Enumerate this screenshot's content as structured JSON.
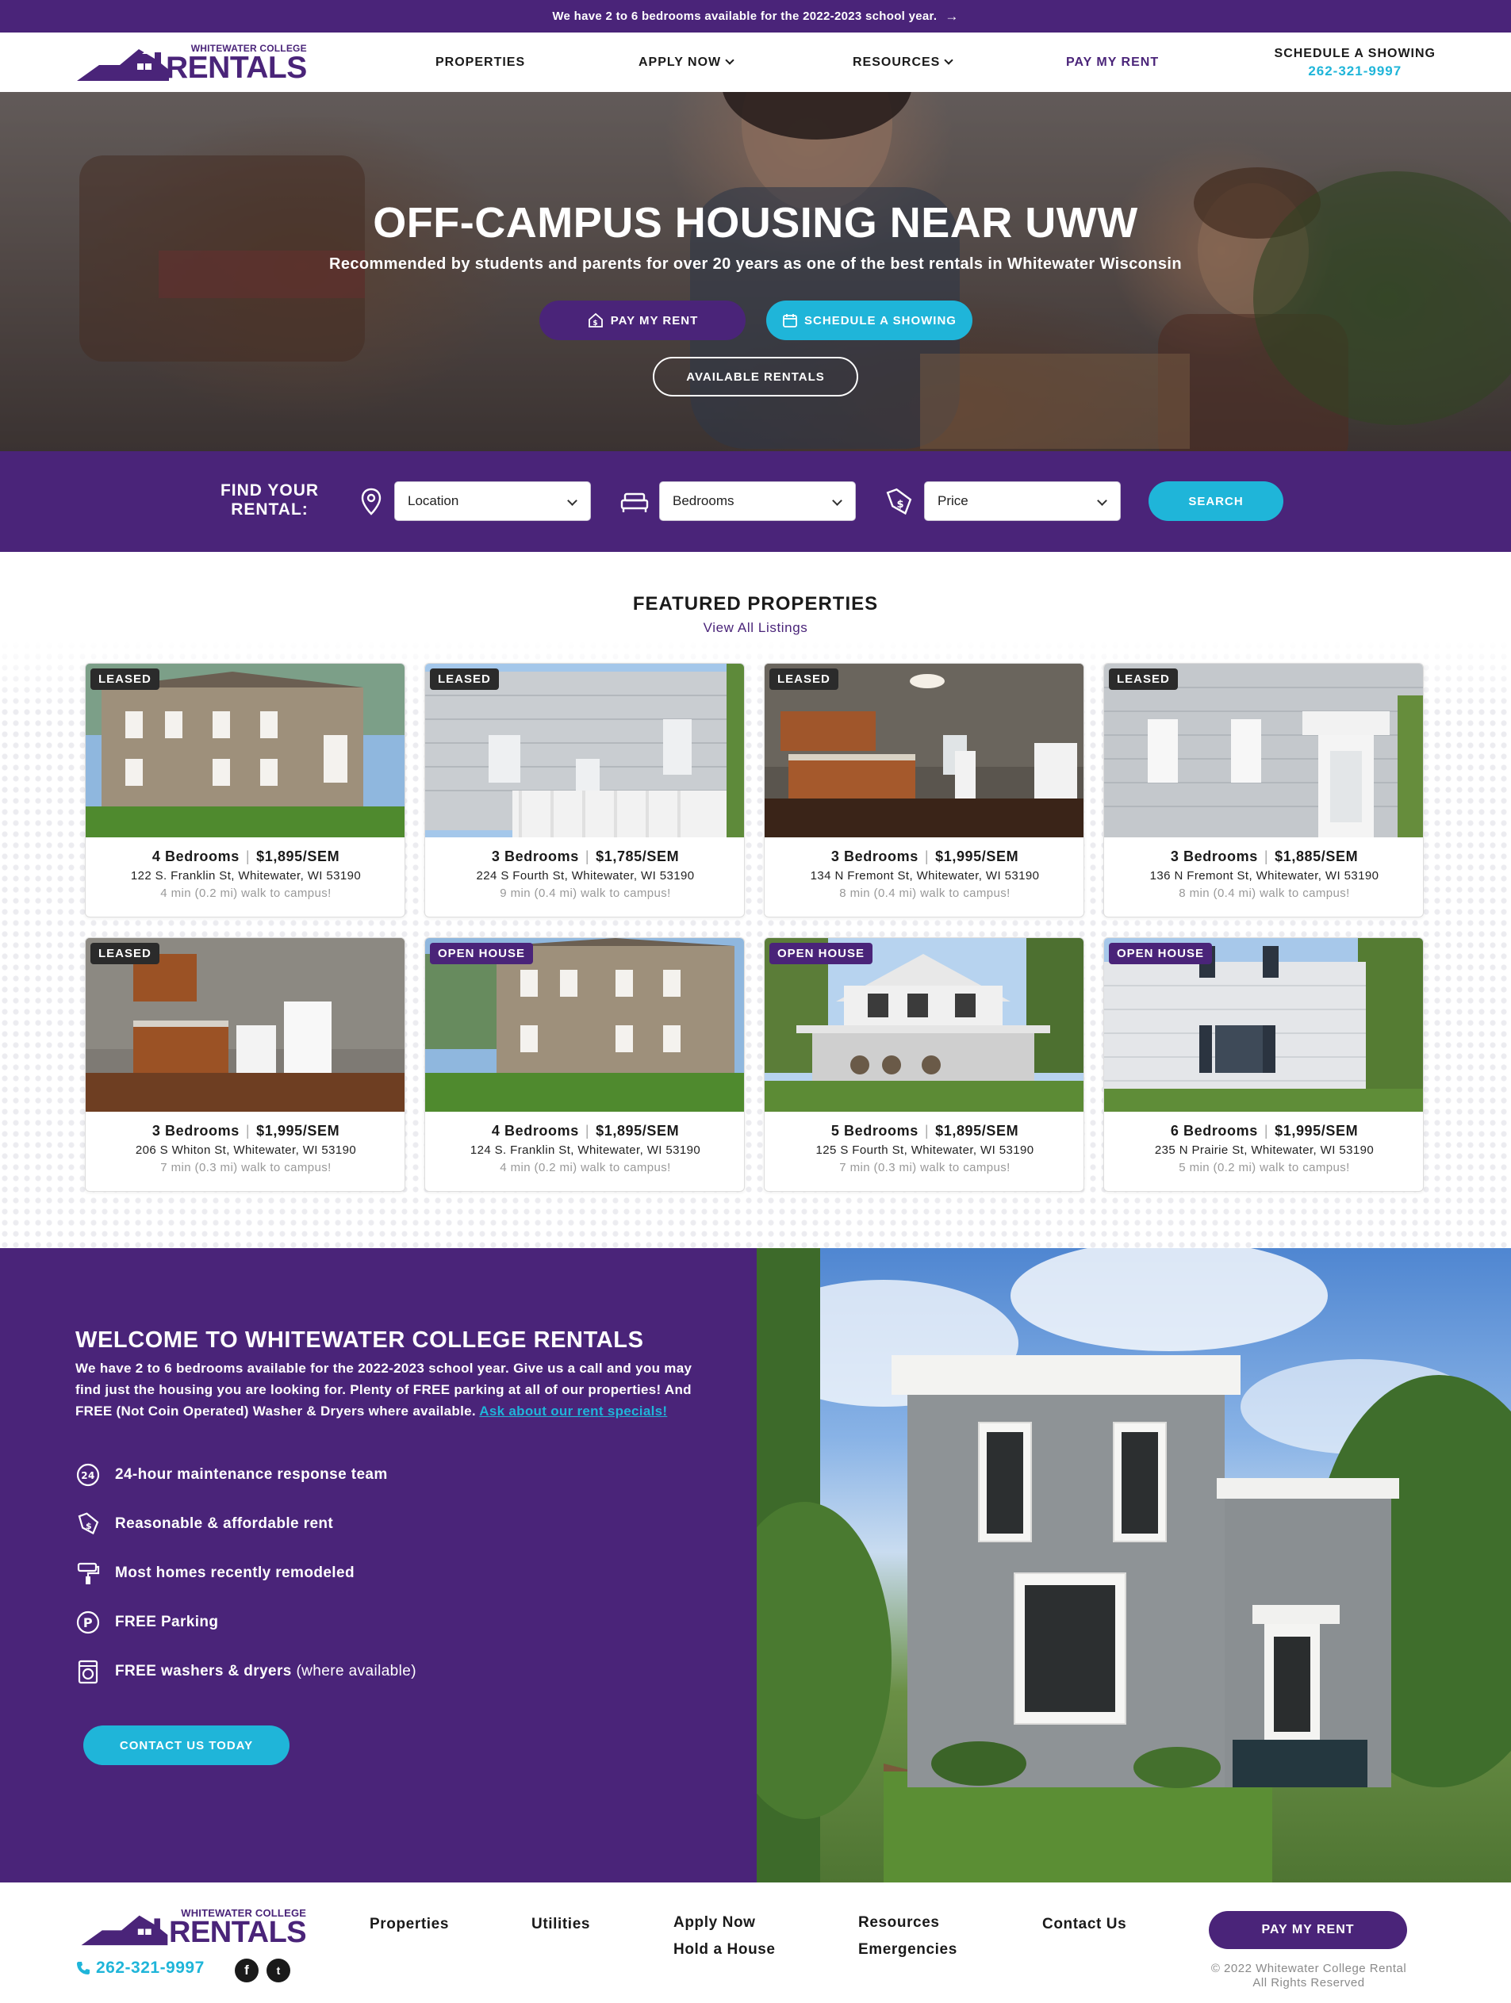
{
  "announcement": {
    "text": "We have 2 to 6 bedrooms available for the 2022-2023 school year.",
    "arrow_icon": "arrow-right-icon"
  },
  "brand": {
    "small": "WHITEWATER COLLEGE",
    "big": "RENTALS",
    "footer_small": "WHITEWATER COLLEGE",
    "footer_big": "RENTALS"
  },
  "nav": {
    "properties": "PROPERTIES",
    "apply_now": "APPLY NOW",
    "resources": "RESOURCES",
    "pay_my_rent": "PAY MY RENT",
    "cta_label": "SCHEDULE A SHOWING",
    "cta_phone": "262-321-9997"
  },
  "hero": {
    "title": "OFF-CAMPUS HOUSING NEAR UWW",
    "subtitle": "Recommended by students and parents for over 20 years as one of the best rentals in Whitewater Wisconsin",
    "pay_rent": "PAY MY RENT",
    "schedule": "SCHEDULE A SHOWING",
    "available": "AVAILABLE RENTALS"
  },
  "search": {
    "label_line1": "FIND YOUR",
    "label_line2": "RENTAL:",
    "location": "Location",
    "bedrooms": "Bedrooms",
    "price": "Price",
    "button": "SEARCH"
  },
  "featured": {
    "title": "FEATURED PROPERTIES",
    "view_all": "View All Listings",
    "cards": [
      {
        "badge": "LEASED",
        "beds": "4 Bedrooms",
        "price": "$1,895/SEM",
        "address": "122 S. Franklin St, Whitewater, WI 53190",
        "walk": "4 min (0.2 mi) walk to campus!"
      },
      {
        "badge": "LEASED",
        "beds": "3 Bedrooms",
        "price": "$1,785/SEM",
        "address": "224 S Fourth St, Whitewater, WI 53190",
        "walk": "9 min (0.4 mi) walk to campus!"
      },
      {
        "badge": "LEASED",
        "beds": "3 Bedrooms",
        "price": "$1,995/SEM",
        "address": "134 N Fremont St, Whitewater, WI 53190",
        "walk": "8 min (0.4 mi) walk to campus!"
      },
      {
        "badge": "LEASED",
        "beds": "3 Bedrooms",
        "price": "$1,885/SEM",
        "address": "136 N Fremont St, Whitewater, WI 53190",
        "walk": "8 min (0.4 mi) walk to campus!"
      },
      {
        "badge": "LEASED",
        "beds": "3 Bedrooms",
        "price": "$1,995/SEM",
        "address": "206 S Whiton St, Whitewater, WI 53190",
        "walk": "7 min (0.3 mi) walk to campus!"
      },
      {
        "badge": "OPEN HOUSE",
        "beds": "4 Bedrooms",
        "price": "$1,895/SEM",
        "address": "124 S. Franklin St, Whitewater, WI 53190",
        "walk": "4 min (0.2 mi) walk to campus!"
      },
      {
        "badge": "OPEN HOUSE",
        "beds": "5 Bedrooms",
        "price": "$1,895/SEM",
        "address": "125 S Fourth St, Whitewater, WI 53190",
        "walk": "7 min (0.3 mi) walk to campus!"
      },
      {
        "badge": "OPEN HOUSE",
        "beds": "6 Bedrooms",
        "price": "$1,995/SEM",
        "address": "235 N Prairie St, Whitewater, WI 53190",
        "walk": "5 min (0.2 mi) walk to campus!"
      }
    ]
  },
  "welcome": {
    "title": "WELCOME TO WHITEWATER COLLEGE RENTALS",
    "body": "We have 2 to 6 bedrooms available for the 2022-2023 school year. Give us a call and you may find just the housing you are looking for. Plenty of FREE parking at all of our properties! And FREE (Not Coin Operated) Washer & Dryers where available.",
    "link": "Ask about our rent specials!",
    "features": {
      "maintenance": "24-hour maintenance response team",
      "rent": "Reasonable & affordable rent",
      "remodeled": "Most homes recently remodeled",
      "parking": "FREE Parking",
      "washers": "FREE washers & dryers",
      "washers_note": " (where available)"
    },
    "contact_button": "CONTACT US TODAY"
  },
  "footer": {
    "phone": "262-321-9997",
    "links": {
      "properties": "Properties",
      "utilities": "Utilities",
      "apply_now": "Apply Now",
      "hold_house": "Hold a House",
      "resources": "Resources",
      "emergencies": "Emergencies",
      "contact": "Contact Us"
    },
    "pay_button": "PAY MY RENT",
    "copyright_line1": "© 2022 Whitewater College Rental",
    "copyright_line2": "All Rights Reserved"
  },
  "colors": {
    "brand_purple": "#4a2479",
    "accent_cyan": "#1fb5d9"
  }
}
